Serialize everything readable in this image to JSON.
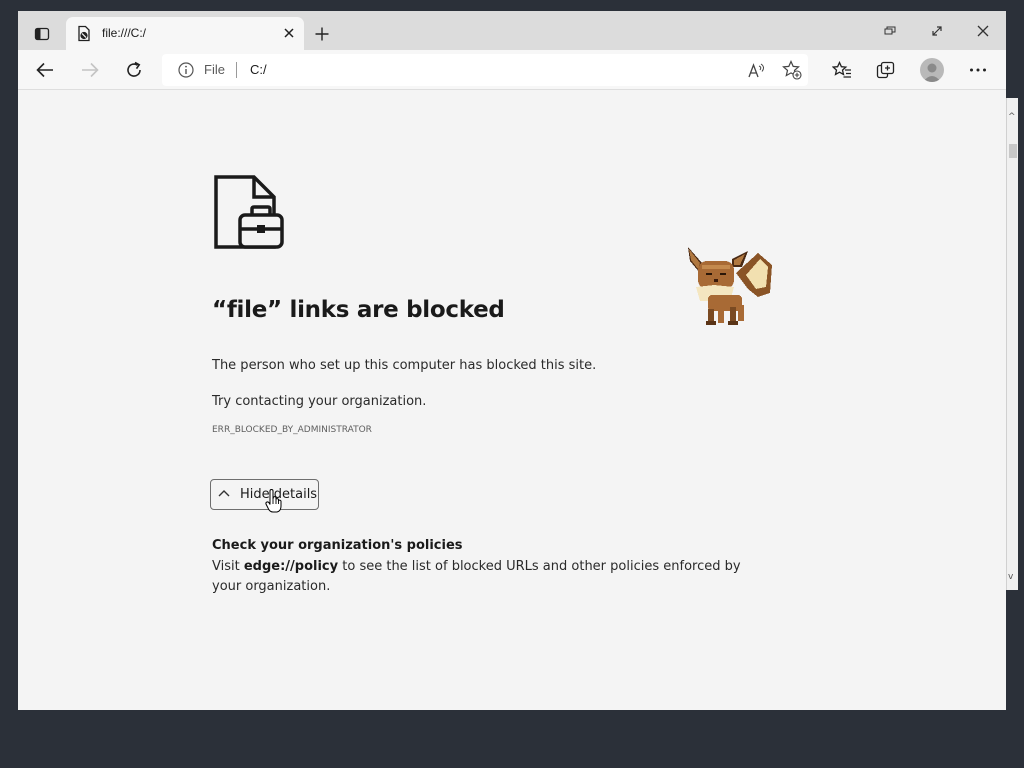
{
  "tab": {
    "title": "file:///C:/"
  },
  "addressbar": {
    "scheme": "File",
    "url": "C:/"
  },
  "icons": {
    "tab_actions": "tab-actions-icon",
    "favicon": "blocked-file-icon",
    "close": "close-icon",
    "new_tab": "plus-icon",
    "back": "back-arrow-icon",
    "forward": "forward-arrow-icon",
    "refresh": "refresh-icon",
    "info": "info-icon",
    "read_aloud": "read-aloud-icon",
    "add_favorite": "add-favorite-icon",
    "favorites": "favorites-icon",
    "collections": "collections-icon",
    "profile": "profile-avatar",
    "more": "more-icon"
  },
  "page": {
    "headline": "“file” links are blocked",
    "line1": "The person who set up this computer has blocked this site.",
    "line2": "Try contacting your organization.",
    "error_code": "ERR_BLOCKED_BY_ADMINISTRATOR",
    "details_button": "Hide details",
    "policy_title": "Check your organization's policies",
    "policy_prefix": "Visit ",
    "policy_link": "edge://policy",
    "policy_suffix": " to see the list of blocked URLs and other policies enforced by your organization."
  },
  "colors": {
    "page_bg": "#f4f4f4",
    "desktop_bg": "#2b3039",
    "mascot_brown": "#a86a35"
  }
}
